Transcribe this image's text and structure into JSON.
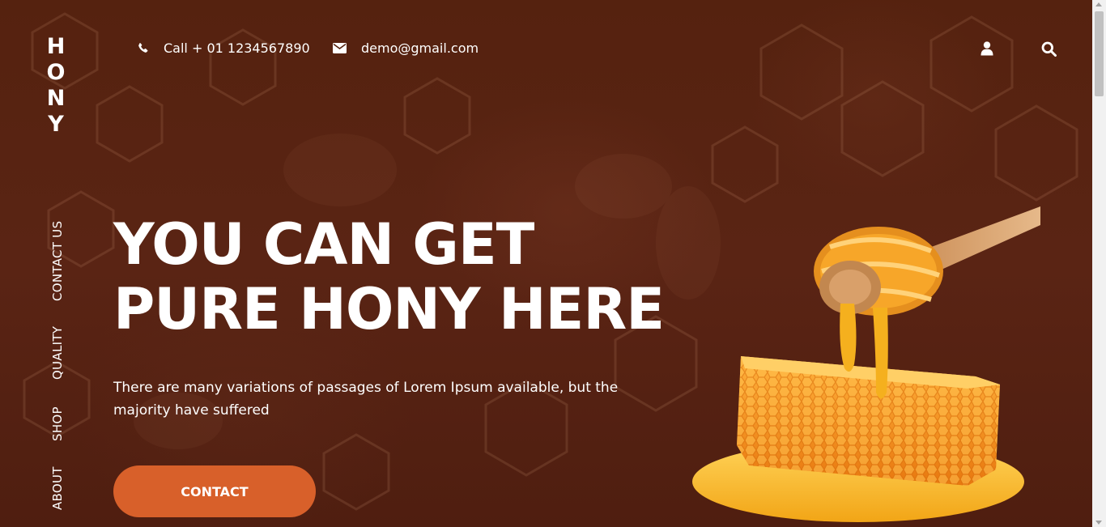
{
  "brand": {
    "logo_letters": [
      "H",
      "O",
      "N",
      "Y"
    ]
  },
  "header": {
    "phone_text": "Call + 01 1234567890",
    "email_text": "demo@gmail.com",
    "phone_icon": "phone-icon",
    "email_icon": "envelope-icon",
    "user_icon": "user-icon",
    "search_icon": "search-icon"
  },
  "side_nav": {
    "items": [
      {
        "label": "CONTACT US"
      },
      {
        "label": "QUALITY"
      },
      {
        "label": "SHOP"
      },
      {
        "label": "ABOUT"
      }
    ]
  },
  "hero": {
    "title_line1": "YOU CAN GET",
    "title_line2": "PURE HONY HERE",
    "description": "There are many variations of passages of Lorem Ipsum available, but the majority have suffered",
    "button_label": "CONTACT"
  },
  "colors": {
    "background": "#55220f",
    "accent_button": "#d8602a",
    "text": "#ffffff",
    "honey": "#f3a321"
  }
}
